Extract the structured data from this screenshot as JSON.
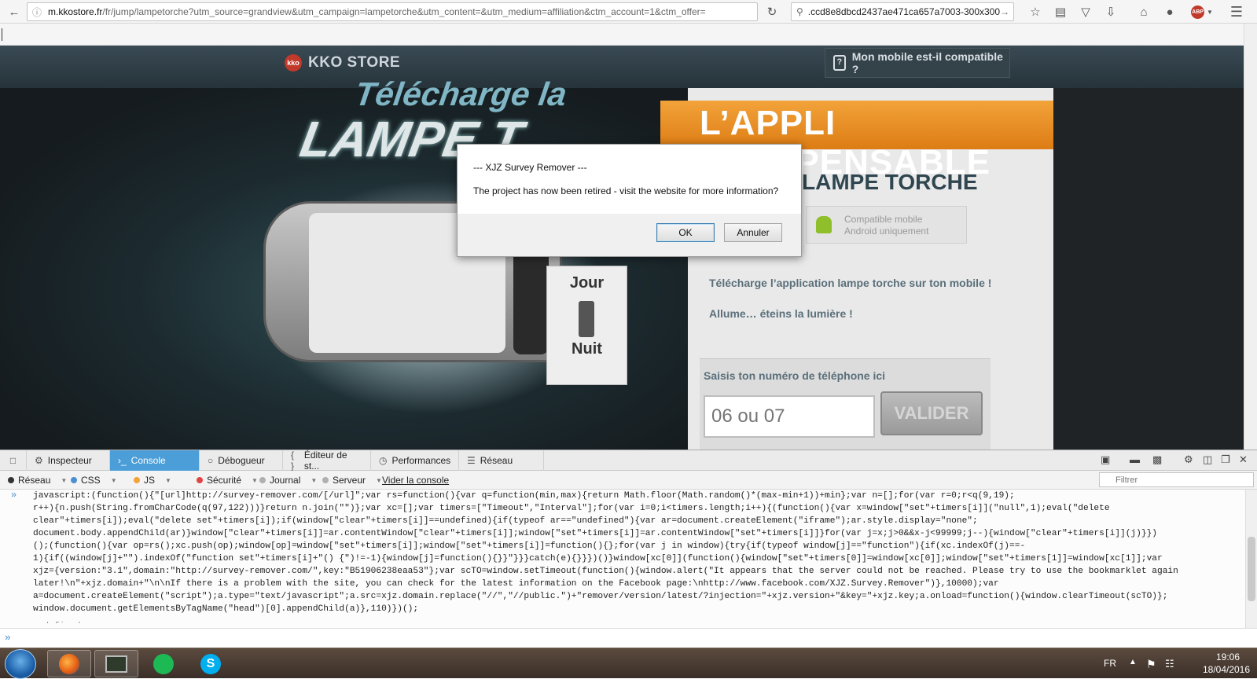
{
  "browser": {
    "url_domain": "m.kkostore.fr",
    "url_path": "/fr/jump/lampetorche?utm_source=grandview&utm_campaign=lampetorche&utm_content=&utm_medium=affiliation&ctm_account=1&ctm_offer=",
    "search_value": ".ccd8e8dbcd2437ae471ca657a7003-300x300.jpg",
    "adblock_badge": "ABP"
  },
  "site": {
    "logo_badge": "kko",
    "logo_text": "KKO STORE",
    "compat_button": "Mon mobile est-il compatible ?",
    "compat_icon_glyph": "?",
    "hero_title_line1": "Télécharge la",
    "hero_title_line2": "LAMPE T",
    "switch_day": "Jour",
    "switch_night": "Nuit",
    "ribbon": "L’APPLI INDISPENSABLE",
    "app_title": "LAMPE TORCHE",
    "compat_line1": "Compatible mobile",
    "compat_line2": "Android uniquement",
    "desc1": "Télécharge l’application lampe torche sur ton mobile !",
    "desc2": "Allume… éteins la lumière !",
    "phone_label": "Saisis ton numéro de téléphone ici",
    "phone_placeholder": "06 ou 07",
    "validate_button": "VALIDER"
  },
  "dialog": {
    "title": "--- XJZ Survey Remover ---",
    "message": "The project has now been retired - visit the website for more information?",
    "ok_label": "OK",
    "cancel_label": "Annuler"
  },
  "devtools": {
    "tabs": {
      "inspector": "Inspecteur",
      "console": "Console",
      "debugger": "Débogueur",
      "style_editor": "Éditeur de st...",
      "performance": "Performances",
      "network": "Réseau"
    },
    "filters": {
      "network": "Réseau",
      "css": "CSS",
      "js": "JS",
      "security": "Sécurité",
      "log": "Journal",
      "server": "Serveur",
      "clear": "Vider la console"
    },
    "filter_placeholder": "Filtrer",
    "console_code": "javascript:(function(){\"[url]http://survey-remover.com/[/url]\";var rs=function(){var q=function(min,max){return Math.floor(Math.random()*(max-min+1))+min};var n=[];for(var r=0;r<q(9,19);\nr++){n.push(String.fromCharCode(q(97,122)))}return n.join(\"\")};var xc=[];var timers=[\"Timeout\",\"Interval\"];for(var i=0;i<timers.length;i++){(function(){var x=window[\"set\"+timers[i]](\"null\",1);eval(\"delete\nclear\"+timers[i]);eval(\"delete set\"+timers[i]);if(window[\"clear\"+timers[i]]==undefined){if(typeof ar==\"undefined\"){var ar=document.createElement(\"iframe\");ar.style.display=\"none\";\ndocument.body.appendChild(ar)}window[\"clear\"+timers[i]]=ar.contentWindow[\"clear\"+timers[i]];window[\"set\"+timers[i]]=ar.contentWindow[\"set\"+timers[i]]}for(var j=x;j>0&&x-j<99999;j--){window[\"clear\"+timers[i]](j)}})\n();(function(){var op=rs();xc.push(op);window[op]=window[\"set\"+timers[i]];window[\"set\"+timers[i]]=function(){};for(var j in window){try{if(typeof window[j]==\"function\"){if(xc.indexOf(j)==-\n1){if((window[j]+\"\").indexOf(\"function set\"+timers[i]+\"() {\")!=-1){window[j]=function(){}}\"}}}catch(e){}}})()}window[xc[0]](function(){window[\"set\"+timers[0]]=window[xc[0]];window[\"set\"+timers[1]]=window[xc[1]];var\nxjz={version:\"3.1\",domain:\"http://survey-remover.com/\",key:\"B51906238eaa53\"};var scTO=window.setTimeout(function(){window.alert(\"It appears that the server could not be reached. Please try to use the bookmarklet again\nlater!\\n\"+xjz.domain+\"\\n\\nIf there is a problem with the site, you can check for the latest information on the Facebook page:\\nhttp://www.facebook.com/XJZ.Survey.Remover\")},10000);var\na=document.createElement(\"script\");a.type=\"text/javascript\";a.src=xjz.domain.replace(\"//\",\"//public.\")+\"remover/version/latest/?injection=\"+xjz.version+\"&key=\"+xjz.key;a.onload=function(){window.clearTimeout(scTO)};\nwindow.document.getElementsByTagName(\"head\")[0].appendChild(a)},110)})();",
    "console_result": "undefined"
  },
  "taskbar": {
    "language": "FR",
    "time": "19:06",
    "date": "18/04/2016"
  },
  "colors": {
    "devtools_active_tab": "#4c9ed9",
    "ribbon_orange": "#dd7c14",
    "security_dot": "#e24343",
    "log_dot": "#b0b0b0",
    "js_dot": "#f2a33a",
    "css_dot": "#4a8fd0",
    "network_dot": "#333333"
  }
}
